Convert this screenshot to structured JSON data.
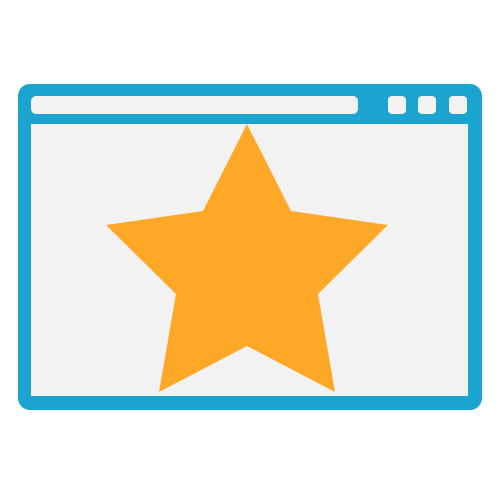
{
  "icon": {
    "name": "browser-window-star-icon",
    "colors": {
      "frame": "#1aa4cf",
      "titlebar_field": "#f2f2f2",
      "window_buttons": "#f2f2f2",
      "content_background": "#f2f2f2",
      "star": "#ffa726",
      "page_background": "#ffffff"
    }
  }
}
